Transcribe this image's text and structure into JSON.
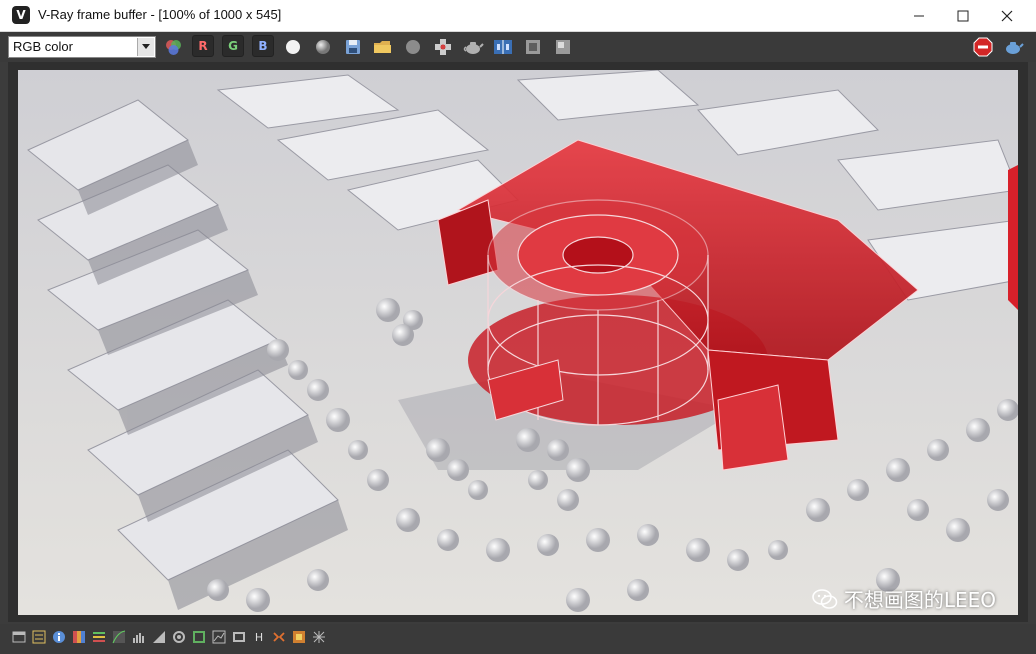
{
  "window": {
    "title": "V-Ray frame buffer - [100% of 1000 x 545]",
    "app_icon_letter": "V"
  },
  "toolbar": {
    "channel_select_value": "RGB color",
    "channel_r": "R",
    "channel_g": "G",
    "channel_b": "B"
  },
  "statusbar": {
    "h_label": "H"
  },
  "watermark": {
    "text": "不想画图的LEEO"
  },
  "colors": {
    "accent_red": "#d8202a",
    "toolbar_bg": "#3a3a3a",
    "window_bg": "#3c3c3c"
  }
}
